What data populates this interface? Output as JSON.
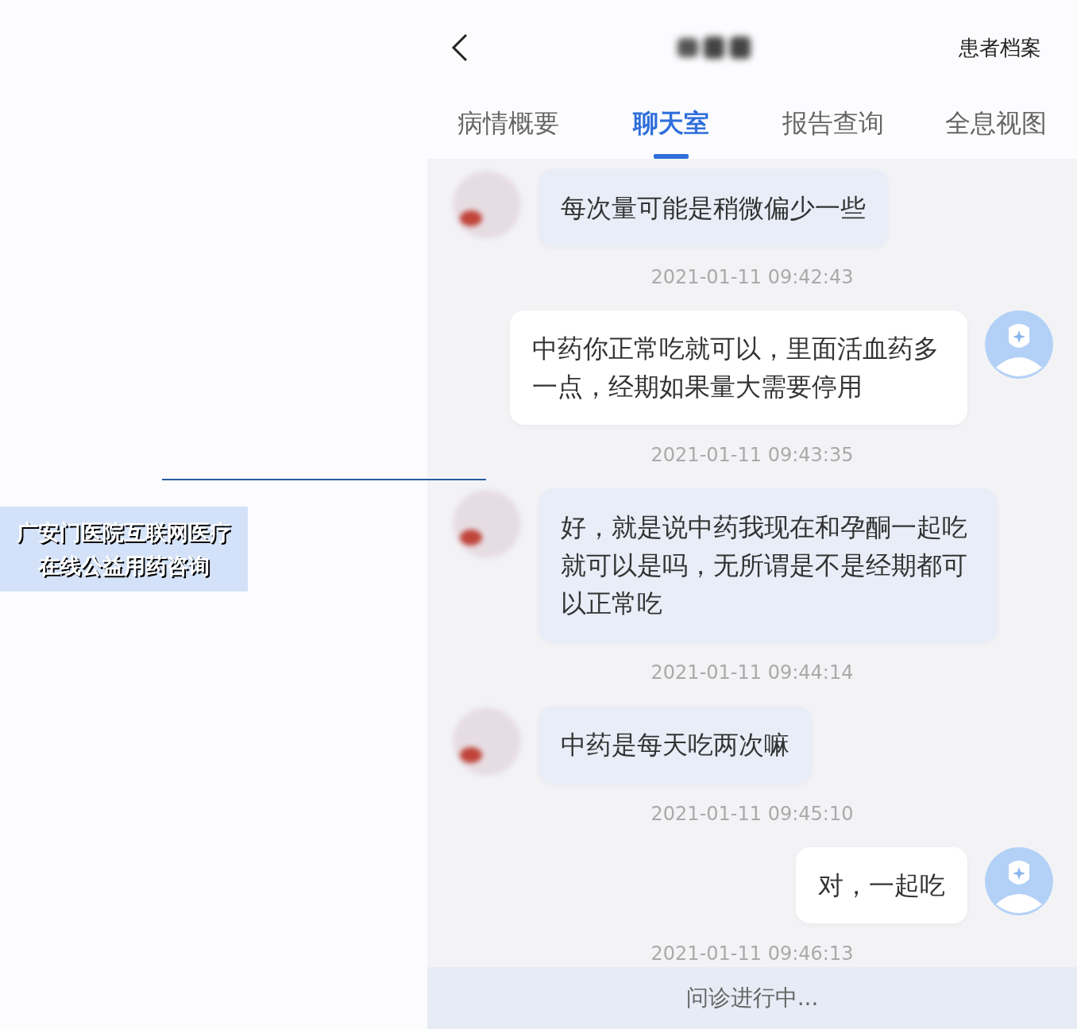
{
  "caption": {
    "lines": [
      "广安门医院互联网医疗",
      "在线公益用药咨询"
    ]
  },
  "header": {
    "right_action": "患者档案"
  },
  "tabs": [
    {
      "label": "病情概要",
      "selected": false
    },
    {
      "label": "聊天室",
      "selected": true
    },
    {
      "label": "报告查询",
      "selected": false
    },
    {
      "label": "全息视图",
      "selected": false
    }
  ],
  "messages": [
    {
      "kind": "patient",
      "text": "每次量可能是稍微偏少一些",
      "time": "2021-01-11 09:42:43"
    },
    {
      "kind": "doctor",
      "text": "中药你正常吃就可以，里面活血药多一点，经期如果量大需要停用",
      "time": "2021-01-11 09:43:35"
    },
    {
      "kind": "patient",
      "text": "好，就是说中药我现在和孕酮一起吃就可以是吗，无所谓是不是经期都可以正常吃",
      "time": "2021-01-11 09:44:14"
    },
    {
      "kind": "patient",
      "text": "中药是每天吃两次嘛",
      "time": "2021-01-11 09:45:10"
    },
    {
      "kind": "doctor",
      "text": "对，一起吃",
      "time": "2021-01-11 09:46:13"
    }
  ],
  "status_bar": {
    "text": "问诊进行中..."
  }
}
